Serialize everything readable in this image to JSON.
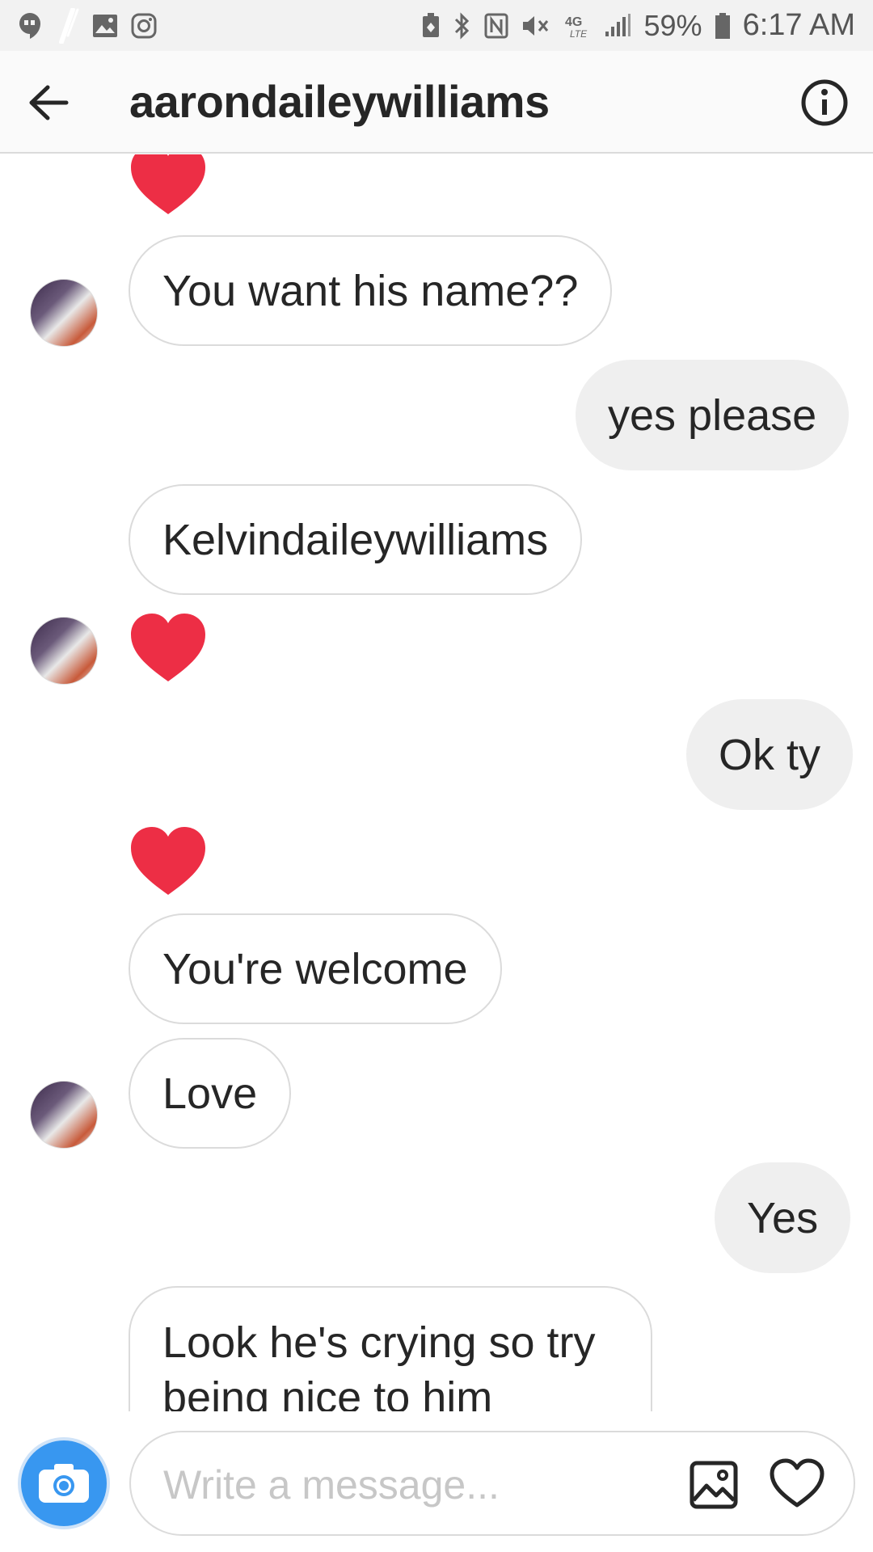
{
  "status_bar": {
    "battery": "59%",
    "time": "6:17 AM",
    "network": "4G LTE"
  },
  "header": {
    "title": "aarondaileywilliams",
    "back_icon": "arrow-left-icon",
    "info_icon": "info-icon"
  },
  "messages": [
    {
      "from": "them",
      "type": "heart"
    },
    {
      "from": "them",
      "type": "text",
      "text": "You want his name??"
    },
    {
      "from": "me",
      "type": "text",
      "text": "yes please"
    },
    {
      "from": "them",
      "type": "text",
      "text": "Kelvindaileywilliams"
    },
    {
      "from": "them",
      "type": "heart"
    },
    {
      "from": "me",
      "type": "text",
      "text": "Ok ty"
    },
    {
      "from": "them",
      "type": "heart"
    },
    {
      "from": "them",
      "type": "text",
      "text": "You're welcome"
    },
    {
      "from": "them",
      "type": "text",
      "text": "Love"
    },
    {
      "from": "me",
      "type": "text",
      "text": "Yes"
    },
    {
      "from": "them",
      "type": "text",
      "text": "Look he's crying so try being nice to him"
    }
  ],
  "composer": {
    "placeholder": "Write a message...",
    "camera_icon": "camera-icon",
    "gallery_icon": "gallery-icon",
    "like_icon": "heart-outline-icon"
  },
  "colors": {
    "heart": "#ed2e45",
    "accent": "#3897f0",
    "outgoing_bubble": "#efefef",
    "border": "#dbdbdb"
  }
}
